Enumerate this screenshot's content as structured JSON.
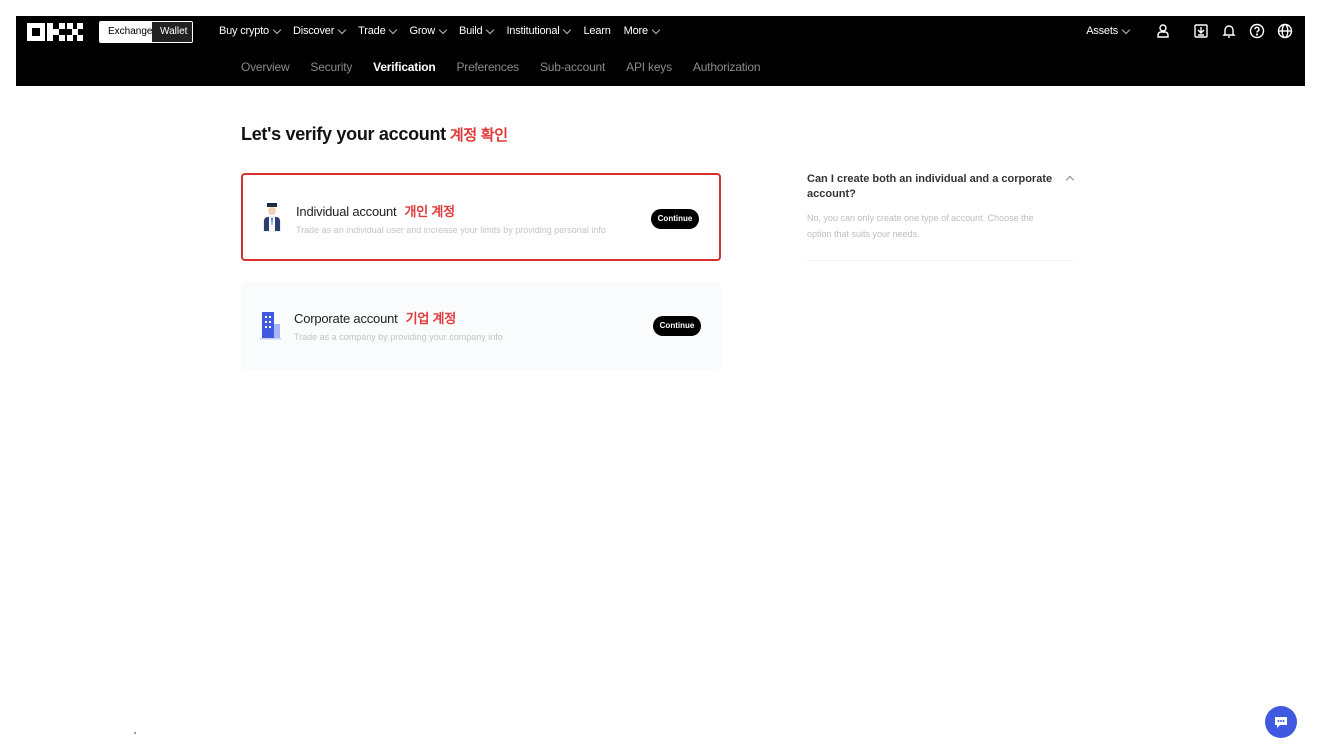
{
  "header": {
    "mode_toggle": {
      "exchange": "Exchange",
      "wallet": "Wallet"
    },
    "main_nav": [
      {
        "label": "Buy crypto",
        "dropdown": true
      },
      {
        "label": "Discover",
        "dropdown": true
      },
      {
        "label": "Trade",
        "dropdown": true
      },
      {
        "label": "Grow",
        "dropdown": true
      },
      {
        "label": "Build",
        "dropdown": true
      },
      {
        "label": "Institutional",
        "dropdown": true
      },
      {
        "label": "Learn",
        "dropdown": false
      },
      {
        "label": "More",
        "dropdown": true
      }
    ],
    "assets_label": "Assets",
    "right_icons": [
      "user-icon",
      "download-icon",
      "bell-icon",
      "help-icon",
      "globe-icon"
    ]
  },
  "subnav": {
    "items": [
      "Overview",
      "Security",
      "Verification",
      "Preferences",
      "Sub-account",
      "API keys",
      "Authorization"
    ],
    "active": "Verification"
  },
  "page": {
    "title": "Let's verify your account",
    "title_annotation": "계정 확인"
  },
  "cards": [
    {
      "title": "Individual account",
      "annotation": "개인 계정",
      "description": "Trade as an individual user and increase your limits by providing personal info",
      "button": "Continue",
      "selected": true,
      "icon": "person-icon"
    },
    {
      "title": "Corporate account",
      "annotation": "기업 계정",
      "description": "Trade as a company by providing your company info",
      "button": "Continue",
      "selected": false,
      "icon": "building-icon"
    }
  ],
  "faq": {
    "question": "Can I create both an individual and a corporate account?",
    "answer": "No, you can only create one type of account. Choose the option that suits your needs."
  },
  "colors": {
    "header_bg": "#000000",
    "highlight_border": "#d9302e",
    "annotation_red": "#e03b3b",
    "chat_blue": "#3f5ae0"
  }
}
